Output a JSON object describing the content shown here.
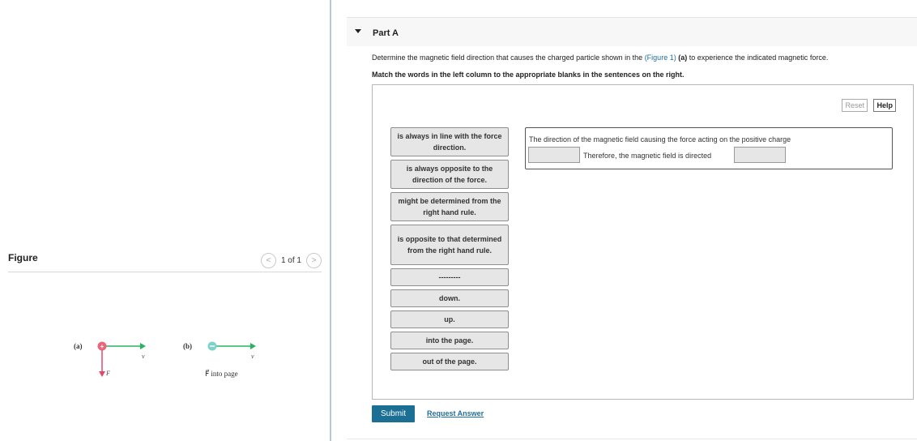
{
  "figure_panel": {
    "title": "Figure",
    "pager_text": "1 of 1",
    "prev_glyph": "<",
    "next_glyph": ">",
    "figure": {
      "label_a": "(a)",
      "label_b": "(b)",
      "v_label": "v⃗",
      "f_label": "F⃗",
      "b_caption": "F⃗ into page",
      "colors": {
        "positive_charge": "#e8677a",
        "negative_charge": "#7ed3c9",
        "velocity_arrow": "#26b45c",
        "force_arrow": "#e24a6a"
      }
    }
  },
  "part": {
    "title": "Part A",
    "question_pre": "Determine the magnetic field direction that causes the charged particle shown in the ",
    "figure_link": "(Figure 1)",
    "question_bold": "(a)",
    "question_post": " to experience the indicated magnetic force.",
    "instruction": "Match the words in the left column to the appropriate blanks in the sentences on the right.",
    "reset_label": "Reset",
    "help_label": "Help",
    "options": [
      "is always in line with the force direction.",
      "is always opposite to the direction of the force.",
      "might be determined from the right hand rule.",
      "is opposite to that determined from the right hand rule.",
      "---------",
      "down.",
      "up.",
      "into the page.",
      "out of the page."
    ],
    "sentence_line1": "The direction of the magnetic field causing the force acting on the positive charge",
    "sentence_line2": "Therefore, the magnetic field is directed",
    "submit_label": "Submit",
    "request_label": "Request Answer"
  }
}
